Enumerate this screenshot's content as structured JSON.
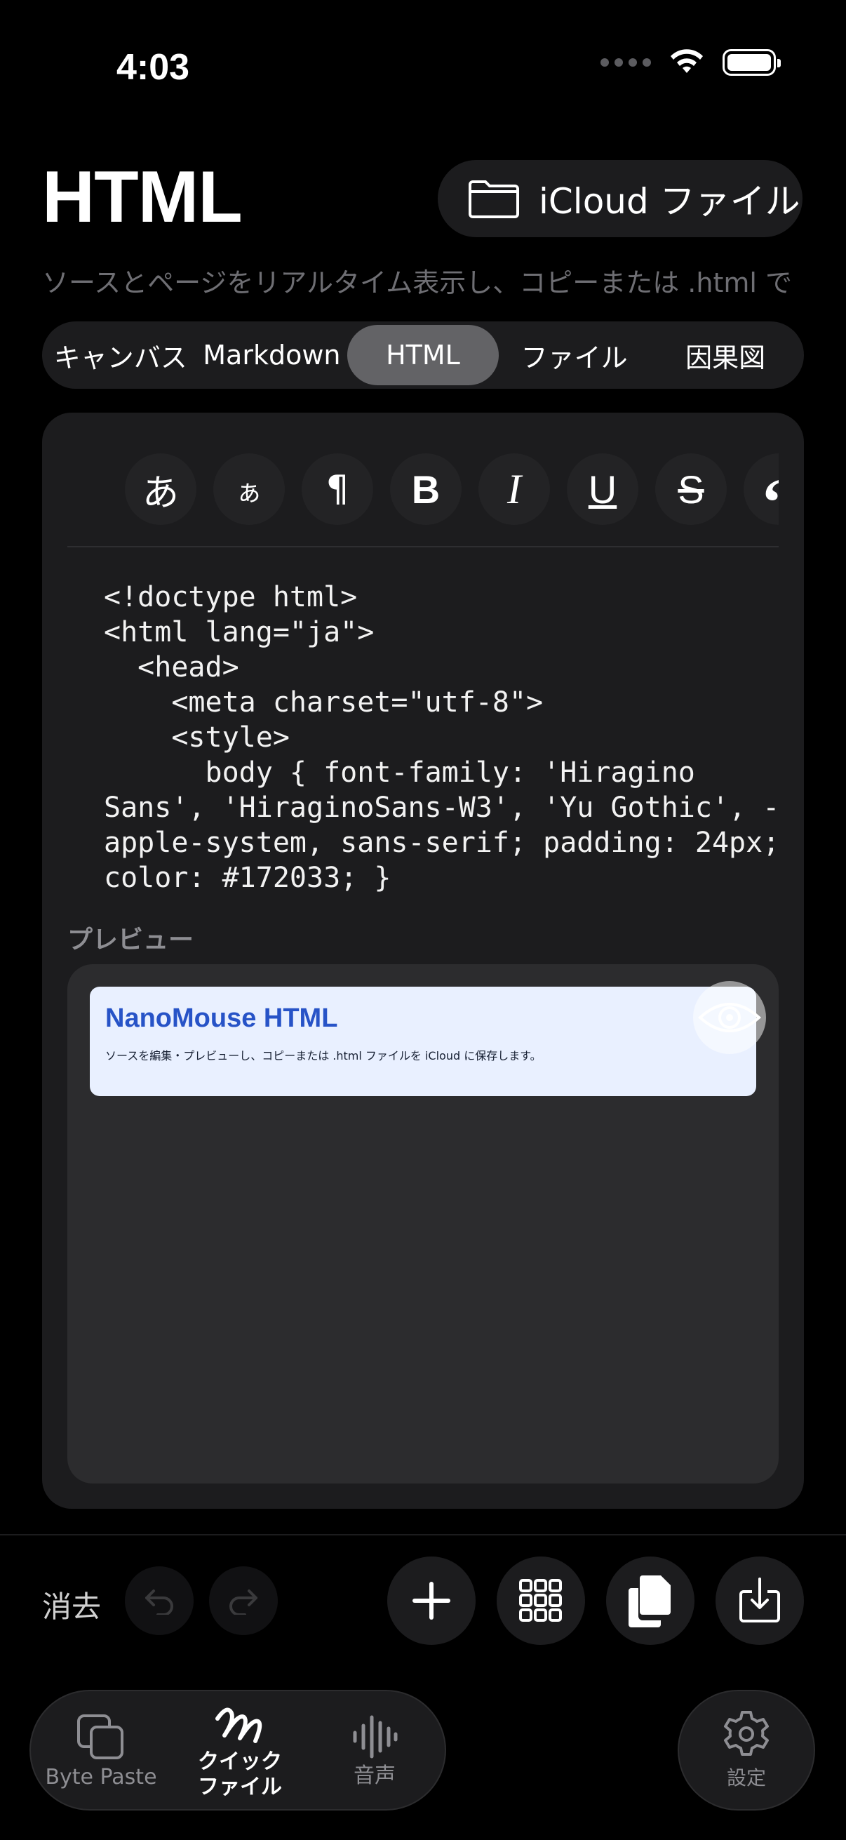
{
  "status": {
    "time": "4:03"
  },
  "header": {
    "title": "HTML",
    "icloud_label": "iCloud ファイル",
    "subtitle": "ソースとページをリアルタイム表示し、コピーまたは .html で"
  },
  "segments": [
    "キャンバス",
    "Markdown",
    "HTML",
    "ファイル",
    "因果図"
  ],
  "active_segment": "HTML",
  "format_buttons": [
    "あ",
    "ぁ",
    "¶",
    "B",
    "I",
    "U",
    "S",
    "“"
  ],
  "code": "<!doctype html>\n<html lang=\"ja\">\n  <head>\n    <meta charset=\"utf-8\">\n    <style>\n      body { font-family: 'Hiragino Sans', 'HiraginoSans-W3', 'Yu Gothic', -apple-system, sans-serif; padding: 24px; color: #172033; }",
  "preview": {
    "label": "プレビュー",
    "heading": "NanoMouse HTML",
    "body": "ソースを編集・プレビューし、コピーまたは .html ファイルを iCloud に保存します。"
  },
  "actions": {
    "clear_label": "消去"
  },
  "tabs": [
    {
      "label": "Byte Paste"
    },
    {
      "label": "クイック\nファイル"
    },
    {
      "label": "音声"
    }
  ],
  "settings_label": "設定",
  "colors": {
    "accent_blue": "#2753c7",
    "preview_bg": "#e9f0ff",
    "segment_active": "#636366"
  }
}
